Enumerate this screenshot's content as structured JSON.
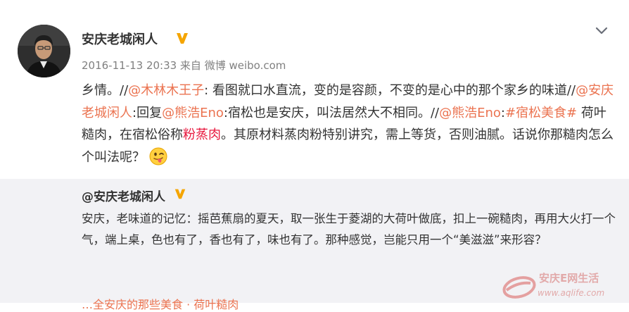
{
  "post": {
    "author": "安庆老城闲人",
    "meta": "2016-11-13 20:33 来自 微博 weibo.com",
    "verified_icon": "verified-v-icon",
    "menu_icon": "chevron-down-icon",
    "body": {
      "t1": "乡情。//",
      "m1": "@木林木王子",
      "t2": ": 看图就口水直流，变的是容颜，不变的是心中的那个家乡的味道//",
      "m2": "@安庆老城闲人",
      "t3": ":回复",
      "m3": "@熊浩Eno",
      "t4": ":宿松也是安庆，叫法居然大不相同。//",
      "m4": "@熊浩Eno",
      "t5": ":",
      "tag": "#宿松美食#",
      "t6": " 荷叶糙肉，在宿松俗称",
      "hl": "粉蒸肉",
      "t7": "。其原材料蒸肉粉特别讲究，需上等货，否则油腻。话说你那糙肉怎么个叫法呢？",
      "emoji": "tongue-out-emoji"
    }
  },
  "quote": {
    "author": "@安庆老城闲人",
    "body": "安庆，老味道的记忆：摇芭蕉扇的夏天，取一张生于菱湖的大荷叶做底，扣上一碗糙肉，再用大火打一个气，端上桌，色也有了，香也有了，味也有了。那种感觉，岂能只用一个“美滋滋”来形容？",
    "next_line": "…全安庆的那些美食 · 荷叶糙肉"
  },
  "watermark": {
    "name": "安庆E网生活",
    "url": "www.aqlife.com"
  },
  "colors": {
    "link": "#eb7350",
    "highlight": "#e8173d",
    "verified": "#f5a500",
    "quote_bg": "#f2f2f5",
    "meta": "#808080"
  }
}
